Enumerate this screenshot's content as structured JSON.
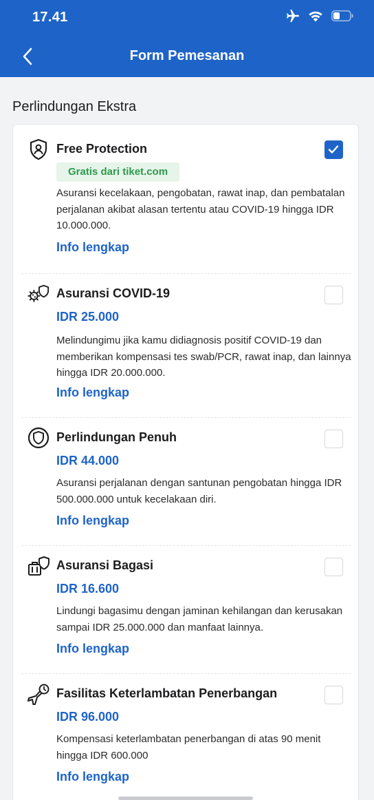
{
  "status_bar": {
    "time": "17.41",
    "icons": [
      "airplane-icon",
      "wifi-icon",
      "battery-icon"
    ]
  },
  "nav": {
    "title": "Form Pemesanan",
    "back_icon": "chevron-left-icon"
  },
  "section": {
    "title": "Perlindungan Ekstra"
  },
  "colors": {
    "header_bg": "#1e64c8",
    "accent": "#1e64c8",
    "badge_bg": "#e6f4e9",
    "badge_text": "#2d9a4c"
  },
  "items": [
    {
      "title": "Free Protection",
      "icon": "shield-person-icon",
      "badge": "Gratis dari tiket.com",
      "description": "Asuransi kecelakaan, pengobatan, rawat inap, dan pembatalan perjalanan akibat alasan tertentu atau COVID-19 hingga IDR 10.000.000.",
      "link": "Info lengkap",
      "checked": true
    },
    {
      "title": "Asuransi COVID-19",
      "icon": "virus-shield-icon",
      "price": "IDR 25.000",
      "description": "Melindungimu jika kamu didiagnosis positif COVID-19 dan memberikan kompensasi tes swab/PCR, rawat inap, dan lainnya hingga IDR 20.000.000.",
      "link": "Info lengkap",
      "checked": false
    },
    {
      "title": "Perlindungan Penuh",
      "icon": "shield-circle-icon",
      "price": "IDR 44.000",
      "description": "Asuransi perjalanan dengan santunan pengobatan hingga IDR 500.000.000 untuk kecelakaan diri.",
      "link": "Info lengkap",
      "checked": false
    },
    {
      "title": "Asuransi Bagasi",
      "icon": "luggage-shield-icon",
      "price": "IDR 16.600",
      "description": "Lindungi bagasimu dengan jaminan kehilangan dan kerusakan sampai IDR 25.000.000 dan manfaat lainnya.",
      "link": "Info lengkap",
      "checked": false
    },
    {
      "title": "Fasilitas Keterlambatan Penerbangan",
      "icon": "plane-delay-icon",
      "price": "IDR 96.000",
      "description": "Kompensasi keterlambatan penerbangan di atas 90 menit hingga IDR 600.000",
      "link": "Info lengkap",
      "checked": false
    }
  ]
}
